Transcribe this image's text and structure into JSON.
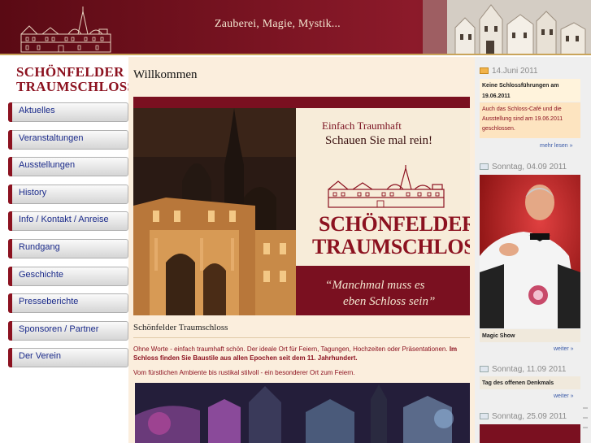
{
  "header": {
    "tagline": "Zauberei, Magie, Mystik..."
  },
  "brand": {
    "line1": "SCHÖNFELDER",
    "line2": "TRAUMSCHLOSS"
  },
  "nav": [
    {
      "label": "Aktuelles"
    },
    {
      "label": "Veranstaltungen"
    },
    {
      "label": "Ausstellungen"
    },
    {
      "label": "History"
    },
    {
      "label": "Info / Kontakt / Anreise"
    },
    {
      "label": "Rundgang"
    },
    {
      "label": "Geschichte"
    },
    {
      "label": "Presseberichte"
    },
    {
      "label": "Sponsoren / Partner"
    },
    {
      "label": "Der Verein"
    }
  ],
  "main": {
    "title": "Willkommen",
    "hero": {
      "line1": "Einfach Traumhaft",
      "line2": "Schauen Sie mal rein!",
      "brand1": "SCHÖNFELDER",
      "brand2": "TRAUMSCHLOSS",
      "trademark": "®",
      "quote1": "“Manchmal muss es",
      "quote2": "eben Schloss sein”"
    },
    "caption": "Schönfelder Traumschloss",
    "para1_normal": "Ohne Worte - einfach traumhaft schön. Der ideale Ort für Feiern, Tagungen, Hochzeiten oder Präsentationen. ",
    "para1_bold": "Im Schloss finden Sie Baustile aus allen Epochen seit dem 11. Jahrhundert.",
    "para2": "Vom fürstlichen Ambiente bis rustikal stilvoll - ein besonderer Ort zum Feiern."
  },
  "right": {
    "items": [
      {
        "date": "14.Juni 2011",
        "title": "Keine Schlossführungen am 19.06.2011",
        "body": "Auch das Schloss-Café und die Ausstellung sind am 19.06.2011 geschlossen.",
        "more": "mehr lesen »"
      },
      {
        "date": "Sonntag, 04.09 2011",
        "title": "Magic Show",
        "more": "weiter »"
      },
      {
        "date": "Sonntag, 11.09 2011",
        "title": "Tag des offenen Denkmals",
        "more": "weiter »"
      },
      {
        "date": "Sonntag, 25.09 2011"
      }
    ]
  },
  "colors": {
    "brand": "#8c1220",
    "header": "#7a1422",
    "main_bg": "#fbeedd",
    "nav_text": "#1a2a8a",
    "link": "#3a5aa8"
  }
}
